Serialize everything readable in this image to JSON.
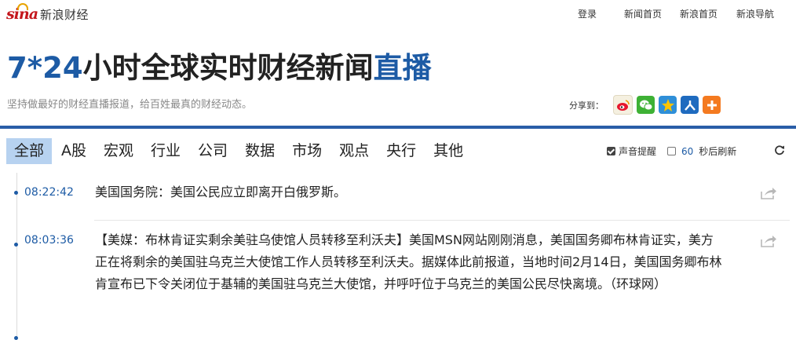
{
  "logo": {
    "sina": "sina",
    "text": "新浪财经"
  },
  "toplinks": [
    "登录",
    "新闻首页",
    "新浪首页",
    "新浪导航"
  ],
  "headline": {
    "prefix": "7*24",
    "middle": "小时全球实时财经新闻",
    "suffix": "直播"
  },
  "subtitle": "坚持做最好的财经直播报道，给百姓最真的财经动态。",
  "share": {
    "label": "分享到：",
    "icons": [
      "weibo-icon",
      "wechat-icon",
      "qzone-icon",
      "renren-icon",
      "more-share-icon"
    ]
  },
  "tabs": [
    "全部",
    "A股",
    "宏观",
    "行业",
    "公司",
    "数据",
    "市场",
    "观点",
    "央行",
    "其他"
  ],
  "active_tab": "全部",
  "controls": {
    "sound_label": "声音提醒",
    "sound_on": true,
    "refresh_seconds": "60",
    "refresh_label": "秒后刷新"
  },
  "feed": [
    {
      "time": "08:22:42",
      "text": "美国国务院：美国公民应立即离开白俄罗斯。"
    },
    {
      "time": "08:03:36",
      "text": "【美媒：布林肯证实剩余美驻乌使馆人员转移至利沃夫】美国MSN网站刚刚消息，美国国务卿布林肯证实，美方正在将剩余的美国驻乌克兰大使馆工作人员转移至利沃夫。据媒体此前报道，当地时间2月14日，美国国务卿布林肯宣布已下令关闭位于基辅的美国驻乌克兰大使馆，并呼吁位于乌克兰的美国公民尽快离境。（环球网）"
    }
  ],
  "colors": {
    "brand_blue": "#1d5ba5",
    "sina_red": "#c4161c",
    "tab_active_bg": "#b7d2f0"
  }
}
